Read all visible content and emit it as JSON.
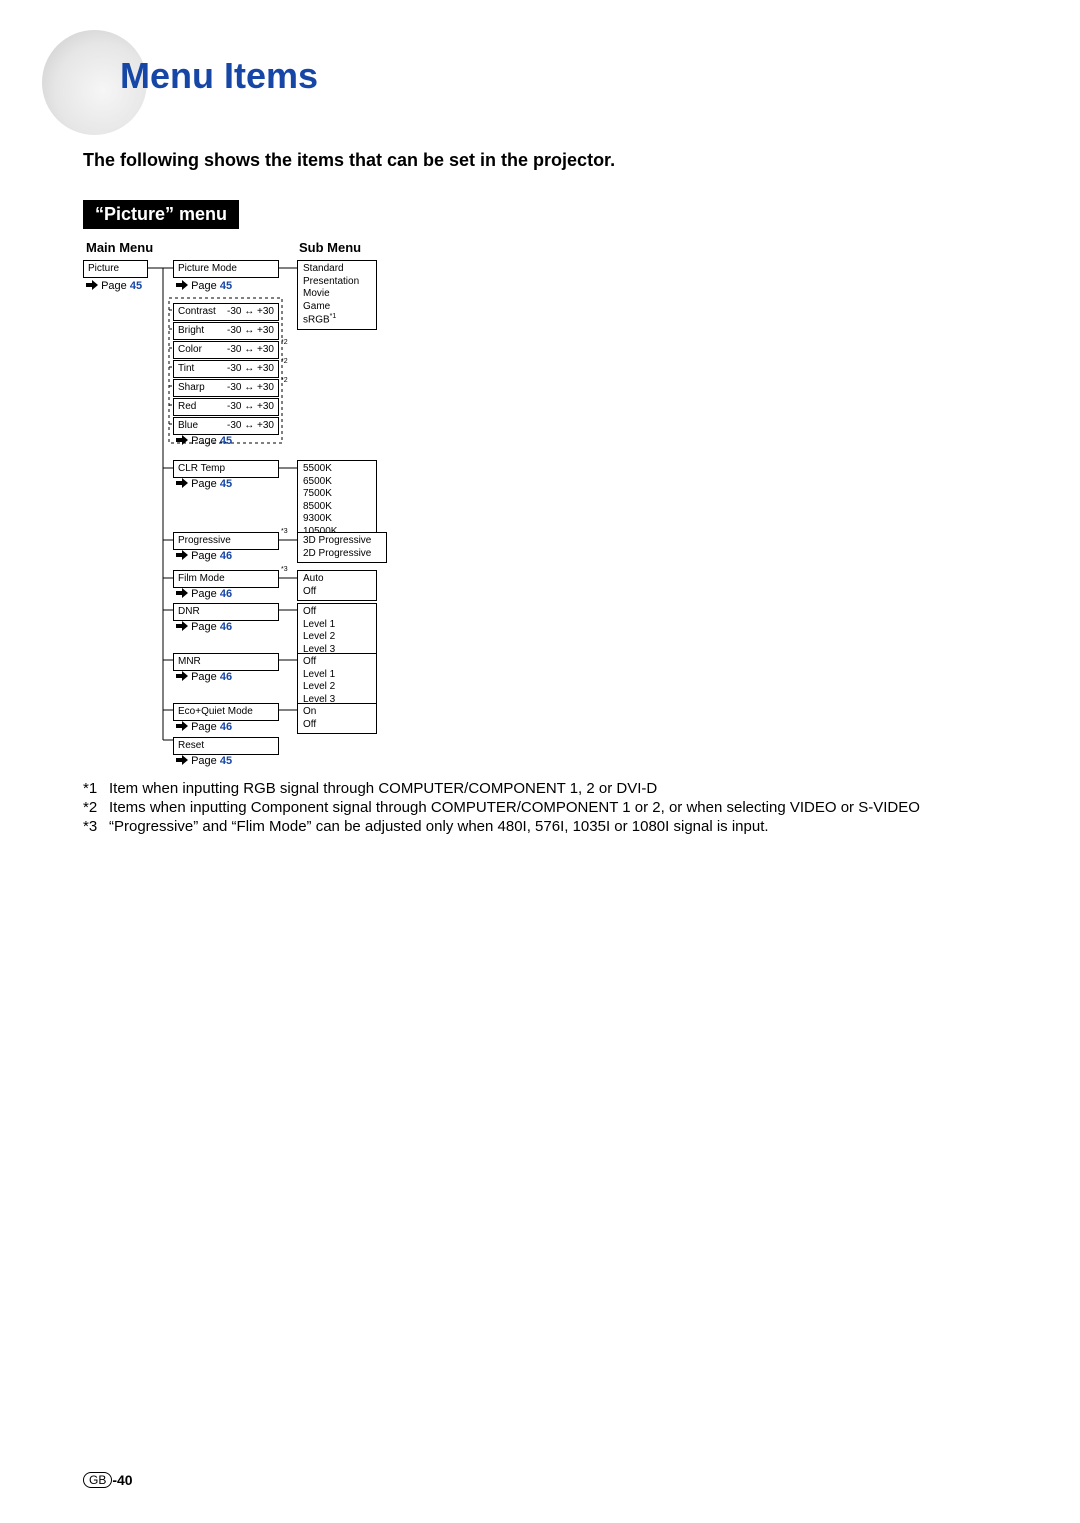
{
  "title": "Menu Items",
  "intro": "The following shows the items that can be set in the projector.",
  "section": "“Picture” menu",
  "column_headers": {
    "main": "Main Menu",
    "sub": "Sub Menu"
  },
  "page_word": "Page",
  "main_menu": {
    "item": "Picture",
    "page": "45"
  },
  "middle": {
    "picture_mode": {
      "label": "Picture Mode",
      "page": "45"
    },
    "sliders": [
      {
        "label": "Contrast",
        "range": "-30 ↔ +30"
      },
      {
        "label": "Bright",
        "range": "-30 ↔ +30"
      },
      {
        "label": "Color",
        "range": "-30 ↔ +30",
        "note": "*2"
      },
      {
        "label": "Tint",
        "range": "-30 ↔ +30",
        "note": "*2"
      },
      {
        "label": "Sharp",
        "range": "-30 ↔ +30",
        "note": "*2"
      },
      {
        "label": "Red",
        "range": "-30 ↔ +30"
      },
      {
        "label": "Blue",
        "range": "-30 ↔ +30"
      }
    ],
    "sliders_page": "45",
    "clr_temp": {
      "label": "CLR Temp",
      "page": "45"
    },
    "progressive": {
      "label": "Progressive",
      "page": "46",
      "note": "*3"
    },
    "film_mode": {
      "label": "Film Mode",
      "page": "46",
      "note": "*3"
    },
    "dnr": {
      "label": "DNR",
      "page": "46"
    },
    "mnr": {
      "label": "MNR",
      "page": "46"
    },
    "eco": {
      "label": "Eco+Quiet Mode",
      "page": "46"
    },
    "reset": {
      "label": "Reset",
      "page": "45"
    }
  },
  "sub": {
    "picture_mode": [
      "Standard",
      "Presentation",
      "Movie",
      "Game",
      "sRGB"
    ],
    "picture_mode_note": "*1",
    "clr_temp": [
      "5500K",
      "6500K",
      "7500K",
      "8500K",
      "9300K",
      "10500K"
    ],
    "progressive": [
      "3D Progressive",
      "2D Progressive"
    ],
    "film_mode": [
      "Auto",
      "Off"
    ],
    "dnr": [
      "Off",
      "Level 1",
      "Level 2",
      "Level 3"
    ],
    "mnr": [
      "Off",
      "Level 1",
      "Level 2",
      "Level 3"
    ],
    "eco": [
      "On",
      "Off"
    ]
  },
  "footnotes": [
    {
      "mark": "*1",
      "text": "Item when inputting RGB signal through COMPUTER/COMPONENT 1, 2 or DVI-D"
    },
    {
      "mark": "*2",
      "text": "Items when inputting Component signal through COMPUTER/COMPONENT 1 or 2, or when selecting VIDEO or S-VIDEO"
    },
    {
      "mark": "*3",
      "text": "“Progressive” and “Flim Mode” can be adjusted only when 480I, 576I, 1035I or 1080I signal is input."
    }
  ],
  "page_number": {
    "prefix": "GB",
    "value": "-40"
  }
}
